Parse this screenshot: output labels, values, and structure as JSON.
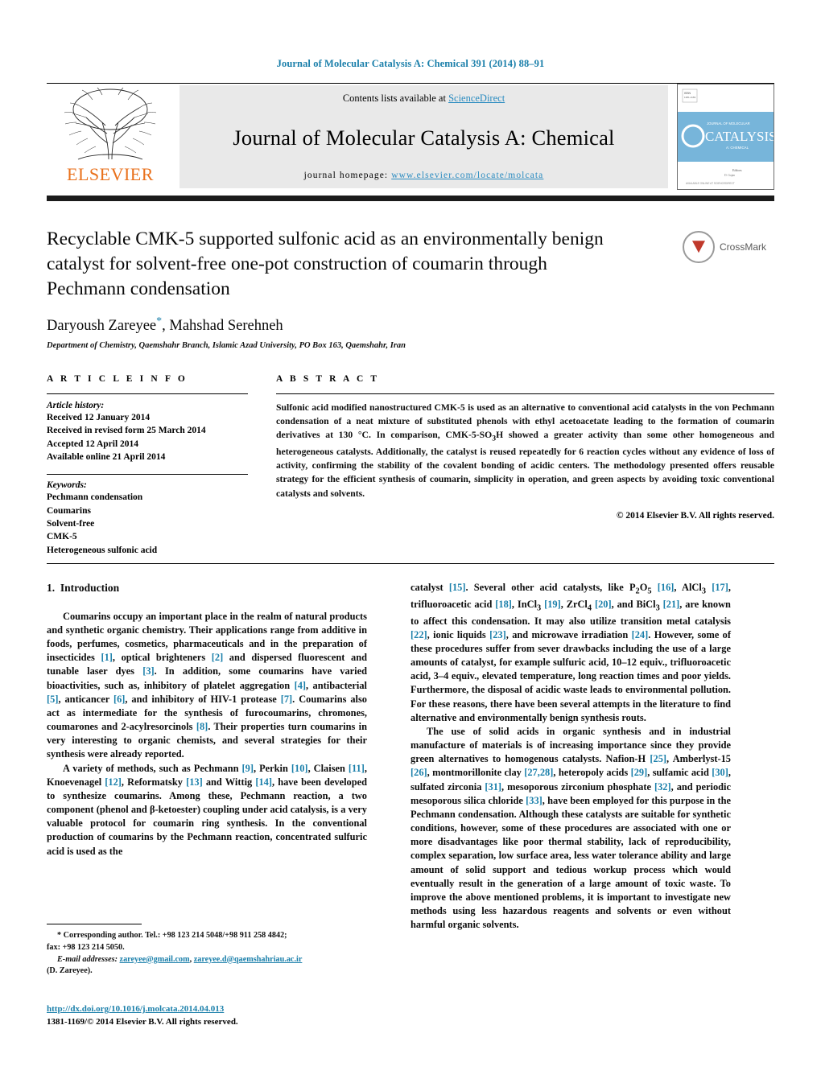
{
  "running_head": "Journal of Molecular Catalysis A: Chemical 391 (2014) 88–91",
  "header": {
    "contents_prefix": "Contents lists available at ",
    "contents_link": "ScienceDirect",
    "journal_name": "Journal of Molecular Catalysis A: Chemical",
    "homepage_prefix": "journal homepage: ",
    "homepage_url": "www.elsevier.com/locate/molcata",
    "publisher": "ELSEVIER",
    "cover_title_line1": "JOURNAL OF MOLECULAR",
    "cover_title_line2": "CATALYSIS",
    "cover_title_line3": "A: CHEMICAL"
  },
  "crossmark": {
    "label": "CrossMark"
  },
  "article": {
    "title": "Recyclable CMK-5 supported sulfonic acid as an environmentally benign catalyst for solvent-free one-pot construction of coumarin through Pechmann condensation",
    "authors": "Daryoush Zareyee",
    "author_marker": "*",
    "authors_rest": ", Mahshad Serehneh",
    "affiliation": "Department of Chemistry, Qaemshahr Branch, Islamic Azad University, PO Box 163, Qaemshahr, Iran"
  },
  "article_info": {
    "label": "A R T I C L E   I N F O",
    "history_head": "Article history:",
    "history": [
      "Received 12 January 2014",
      "Received in revised form 25 March 2014",
      "Accepted 12 April 2014",
      "Available online 21 April 2014"
    ],
    "keywords_head": "Keywords:",
    "keywords": [
      "Pechmann condensation",
      "Coumarins",
      "Solvent-free",
      "CMK-5",
      "Heterogeneous sulfonic acid"
    ]
  },
  "abstract": {
    "label": "A B S T R A C T",
    "text": "Sulfonic acid modified nanostructured CMK-5 is used as an alternative to conventional acid catalysts in the von Pechmann condensation of a neat mixture of substituted phenols with ethyl acetoacetate leading to the formation of coumarin derivatives at 130 °C. In comparison, CMK-5-SO3H showed a greater activity than some other homogeneous and heterogeneous catalysts. Additionally, the catalyst is reused repeatedly for 6 reaction cycles without any evidence of loss of activity, confirming the stability of the covalent bonding of acidic centers. The methodology presented offers reusable strategy for the efficient synthesis of coumarin, simplicity in operation, and green aspects by avoiding toxic conventional catalysts and solvents.",
    "copyright": "© 2014 Elsevier B.V. All rights reserved."
  },
  "body": {
    "section_number": "1.",
    "section_title": "Introduction",
    "left_paragraph_1": "Coumarins occupy an important place in the realm of natural products and synthetic organic chemistry. Their applications range from additive in foods, perfumes, cosmetics, pharmaceuticals and in the preparation of insecticides [1], optical brighteners [2] and dispersed fluorescent and tunable laser dyes [3]. In addition, some coumarins have varied bioactivities, such as, inhibitory of platelet aggregation [4], antibacterial [5], anticancer [6], and inhibitory of HIV-1 protease [7]. Coumarins also act as intermediate for the synthesis of furocoumarins, chromones, coumarones and 2-acylresorcinols [8]. Their properties turn coumarins in very interesting to organic chemists, and several strategies for their synthesis were already reported.",
    "left_paragraph_2": "A variety of methods, such as Pechmann [9], Perkin [10], Claisen [11], Knoevenagel [12], Reformatsky [13] and Wittig [14], have been developed to synthesize coumarins. Among these, Pechmann reaction, a two component (phenol and β-ketoester) coupling under acid catalysis, is a very valuable protocol for coumarin ring synthesis. In the conventional production of coumarins by the Pechmann reaction, concentrated sulfuric acid is used as the",
    "right_paragraph_1": "catalyst [15]. Several other acid catalysts, like P2O5 [16], AlCl3 [17], trifluoroacetic acid [18], InCl3 [19], ZrCl4 [20], and BiCl3 [21], are known to affect this condensation. It may also utilize transition metal catalysis [22], ionic liquids [23], and microwave irradiation [24]. However, some of these procedures suffer from sever drawbacks including the use of a large amounts of catalyst, for example sulfuric acid, 10–12 equiv., trifluoroacetic acid, 3–4 equiv., elevated temperature, long reaction times and poor yields. Furthermore, the disposal of acidic waste leads to environmental pollution. For these reasons, there have been several attempts in the literature to find alternative and environmentally benign synthesis routs.",
    "right_paragraph_2": "The use of solid acids in organic synthesis and in industrial manufacture of materials is of increasing importance since they provide green alternatives to homogenous catalysts. Nafion-H [25], Amberlyst-15 [26], montmorillonite clay [27,28], heteropoly acids [29], sulfamic acid [30], sulfated zirconia [31], mesoporous zirconium phosphate [32], and periodic mesoporous silica chloride [33], have been employed for this purpose in the Pechmann condensation. Although these catalysts are suitable for synthetic conditions, however, some of these procedures are associated with one or more disadvantages like poor thermal stability, lack of reproducibility, complex separation, low surface area, less water tolerance ability and large amount of solid support and tedious workup process which would eventually result in the generation of a large amount of toxic waste. To improve the above mentioned problems, it is important to investigate new methods using less hazardous reagents and solvents or even without harmful organic solvents."
  },
  "footnotes": {
    "corresponding": "* Corresponding author. Tel.: +98 123 214 5048/+98 911 258 4842;",
    "fax": "fax: +98 123 214 5050.",
    "email_label": "E-mail addresses:",
    "email_1": "zareyee@gmail.com",
    "email_2": "zareyee.d@qaemshahriau.ac.ir",
    "email_suffix": "(D. Zareyee).",
    "doi": "http://dx.doi.org/10.1016/j.molcata.2014.04.013",
    "issn_copyright": "1381-1169/© 2014 Elsevier B.V. All rights reserved."
  },
  "colors": {
    "link": "#1a7faa",
    "elsevier_orange": "#E9711C",
    "band_gray": "#e9e9e9"
  }
}
